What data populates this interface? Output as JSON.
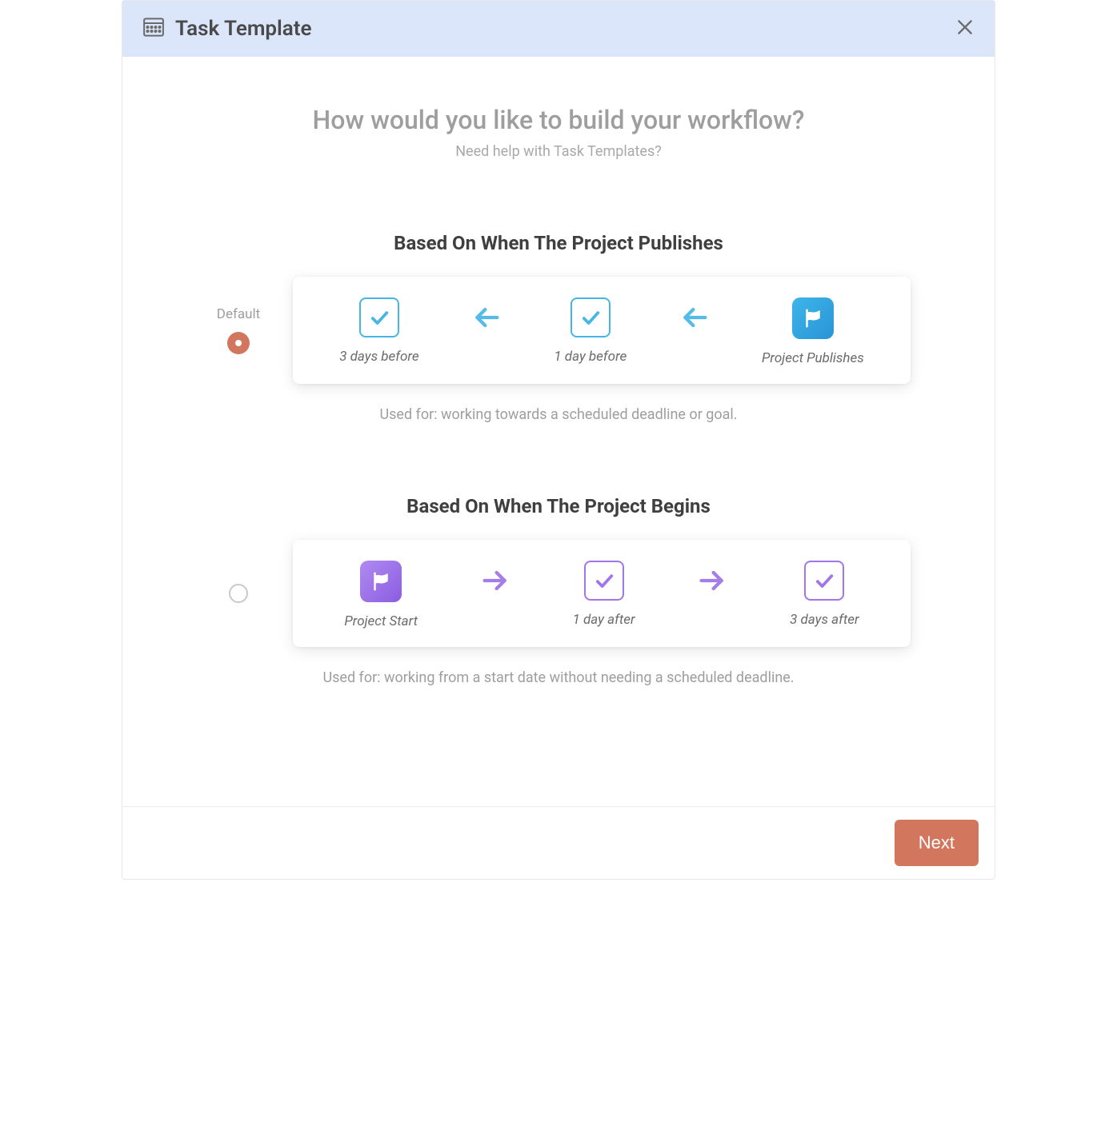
{
  "header": {
    "title": "Task Template"
  },
  "main": {
    "heading": "How would you like to build your workflow?",
    "subheading": "Need help with Task Templates?"
  },
  "options": {
    "publish": {
      "title": "Based On When The Project Publishes",
      "default_label": "Default",
      "selected": true,
      "items": {
        "a": "3 days before",
        "b": "1 day before",
        "c": "Project Publishes"
      },
      "desc": "Used for: working towards a scheduled deadline or goal."
    },
    "begin": {
      "title": "Based On When The Project Begins",
      "selected": false,
      "items": {
        "a": "Project Start",
        "b": "1 day after",
        "c": "3 days after"
      },
      "desc": "Used for: working from a start date without needing a scheduled deadline."
    }
  },
  "footer": {
    "next": "Next"
  }
}
